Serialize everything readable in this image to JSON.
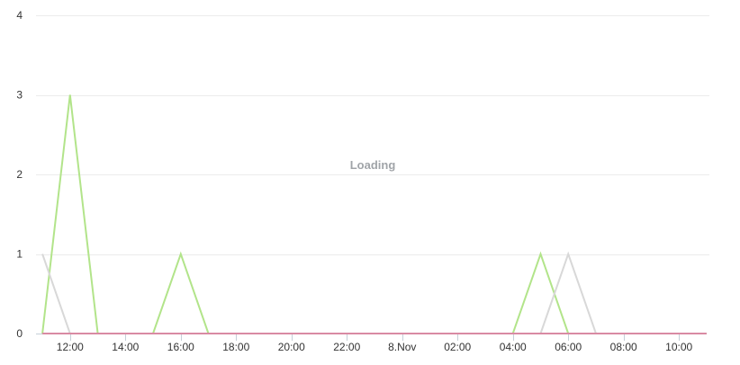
{
  "loading_text": "Loading",
  "chart_data": {
    "type": "line",
    "x_tick_labels": [
      "12:00",
      "14:00",
      "16:00",
      "18:00",
      "20:00",
      "22:00",
      "8.Nov",
      "02:00",
      "04:00",
      "06:00",
      "08:00",
      "10:00"
    ],
    "x_ticks_hours": [
      1,
      3,
      5,
      7,
      9,
      11,
      13,
      15,
      17,
      19,
      21,
      23
    ],
    "x_range_hours": [
      -0.1,
      24.1
    ],
    "x_start_label": "11:00",
    "y_ticks": [
      0,
      1,
      2,
      3,
      4
    ],
    "ylim": [
      0,
      4
    ],
    "grid": true,
    "series": [
      {
        "color": "#b2e48a",
        "points": [
          [
            0,
            0
          ],
          [
            1,
            3
          ],
          [
            2,
            0
          ],
          [
            3,
            0
          ],
          [
            4,
            0
          ],
          [
            5,
            1
          ],
          [
            6,
            0
          ],
          [
            17,
            0
          ],
          [
            18,
            1
          ],
          [
            19,
            0
          ],
          [
            24,
            0
          ]
        ]
      },
      {
        "color": "#d8d8d8",
        "points": [
          [
            0,
            1
          ],
          [
            1,
            0
          ],
          [
            18,
            0
          ],
          [
            19,
            1
          ],
          [
            20,
            0
          ],
          [
            24,
            0
          ]
        ]
      },
      {
        "color": "#d98aa3",
        "points": [
          [
            0,
            0
          ],
          [
            24,
            0
          ]
        ]
      }
    ]
  }
}
